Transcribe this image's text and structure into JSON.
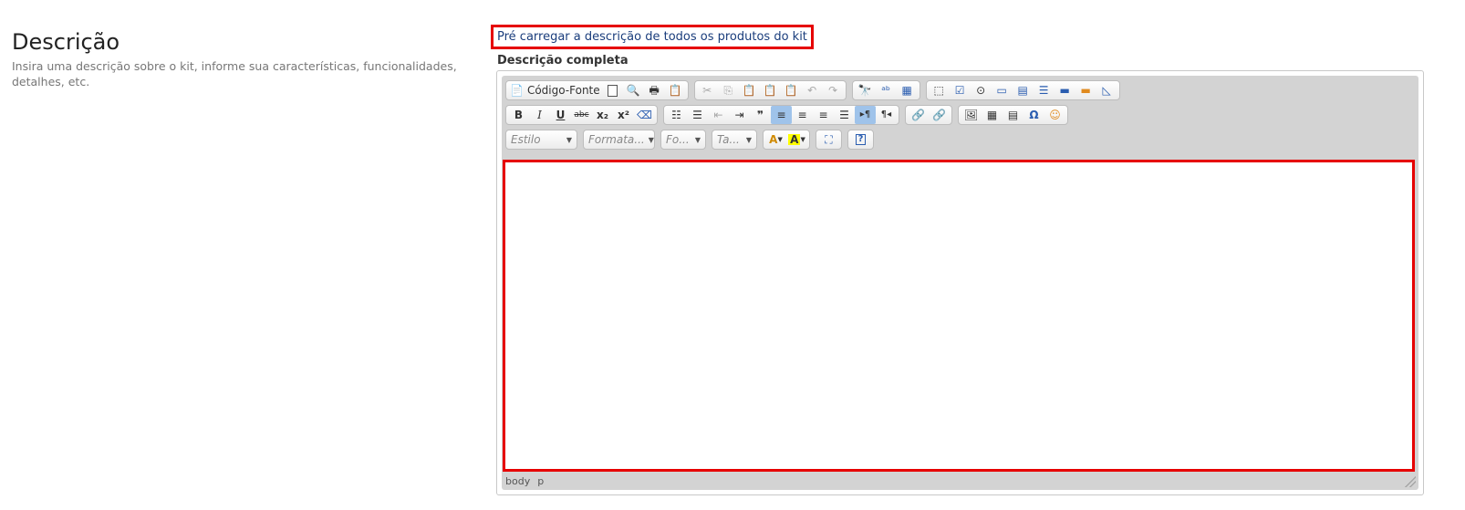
{
  "section": {
    "title": "Descrição",
    "description": "Insira uma descrição sobre o kit, informe sua características, funcionalidades, detalhes, etc."
  },
  "preload_link": "Pré carregar a descrição de todos os produtos do kit",
  "field_label": "Descrição completa",
  "toolbar": {
    "source_label": "Código-Fonte",
    "style_combo": "Estilo",
    "format_combo": "Formata...",
    "font_combo": "Fo...",
    "size_combo": "Ta..."
  },
  "statusbar": {
    "path": [
      "body",
      "p"
    ]
  },
  "colors": {
    "highlight_border": "#e60000",
    "link": "#1a3d7c",
    "editor_bg": "#d3d3d3"
  }
}
